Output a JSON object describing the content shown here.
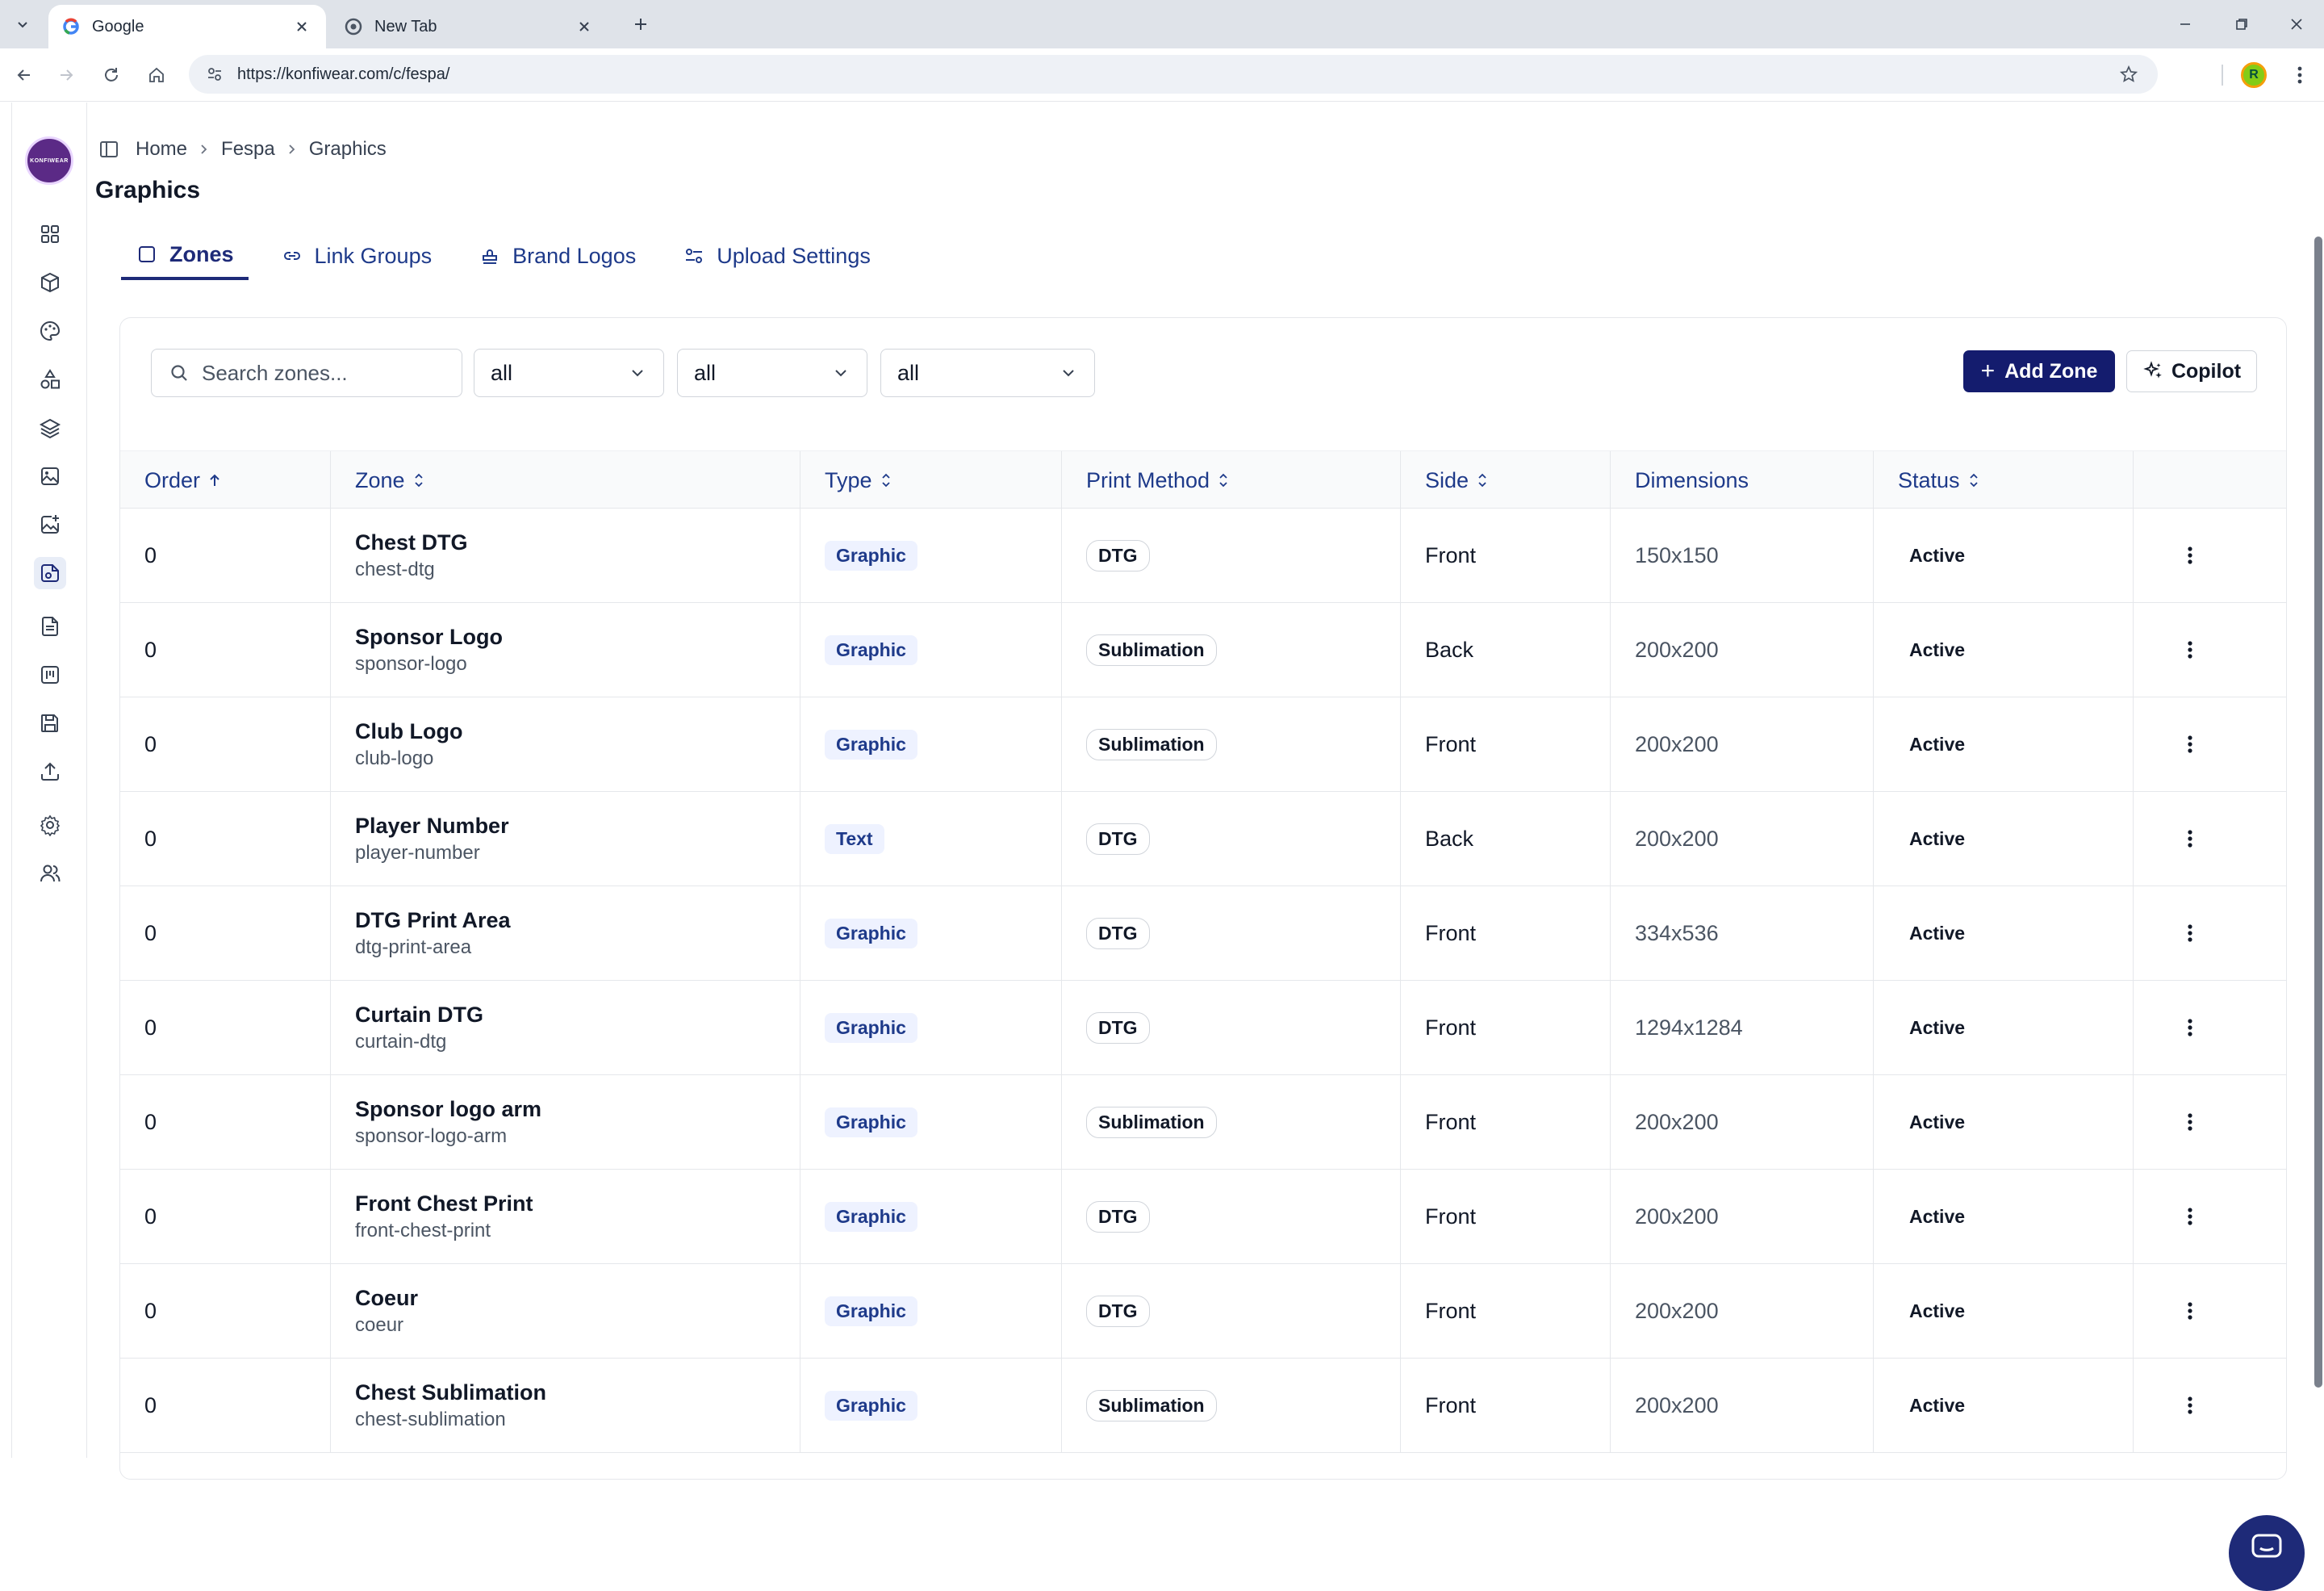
{
  "browser": {
    "tabs": [
      {
        "title": "Google",
        "active": true
      },
      {
        "title": "New Tab",
        "active": false
      }
    ],
    "url": "https://konfiwear.com/c/fespa/"
  },
  "sidebar": {
    "org_initials": "KONFIWEAR",
    "items": [
      "dashboard-icon",
      "box-icon",
      "palette-icon",
      "shapes-icon",
      "layers-icon",
      "image-icon",
      "image-plus-icon",
      "graphics-icon",
      "document-icon",
      "board-icon",
      "save-icon",
      "upload-icon",
      "gear-icon",
      "users-icon"
    ],
    "active_index": 7
  },
  "breadcrumb": [
    "Home",
    "Fespa",
    "Graphics"
  ],
  "page_title": "Graphics",
  "tabs": [
    {
      "label": "Zones",
      "icon": "square-icon",
      "active": true
    },
    {
      "label": "Link Groups",
      "icon": "link-icon",
      "active": false
    },
    {
      "label": "Brand Logos",
      "icon": "stamp-icon",
      "active": false
    },
    {
      "label": "Upload Settings",
      "icon": "sliders-icon",
      "active": false
    }
  ],
  "filters": {
    "search_placeholder": "Search zones...",
    "search_value": "",
    "type_filter": "all",
    "method_filter": "all",
    "side_filter": "all"
  },
  "actions": {
    "add_zone": "Add Zone",
    "copilot": "Copilot"
  },
  "table": {
    "headers": [
      "Order",
      "Zone",
      "Type",
      "Print Method",
      "Side",
      "Dimensions",
      "Status"
    ],
    "rows": [
      {
        "order": "0",
        "name": "Chest DTG",
        "slug": "chest-dtg",
        "type": "Graphic",
        "method": "DTG",
        "side": "Front",
        "dimensions": "150x150",
        "status": "Active"
      },
      {
        "order": "0",
        "name": "Sponsor Logo",
        "slug": "sponsor-logo",
        "type": "Graphic",
        "method": "Sublimation",
        "side": "Back",
        "dimensions": "200x200",
        "status": "Active"
      },
      {
        "order": "0",
        "name": "Club Logo",
        "slug": "club-logo",
        "type": "Graphic",
        "method": "Sublimation",
        "side": "Front",
        "dimensions": "200x200",
        "status": "Active"
      },
      {
        "order": "0",
        "name": "Player Number",
        "slug": "player-number",
        "type": "Text",
        "method": "DTG",
        "side": "Back",
        "dimensions": "200x200",
        "status": "Active"
      },
      {
        "order": "0",
        "name": "DTG Print Area",
        "slug": "dtg-print-area",
        "type": "Graphic",
        "method": "DTG",
        "side": "Front",
        "dimensions": "334x536",
        "status": "Active"
      },
      {
        "order": "0",
        "name": "Curtain DTG",
        "slug": "curtain-dtg",
        "type": "Graphic",
        "method": "DTG",
        "side": "Front",
        "dimensions": "1294x1284",
        "status": "Active"
      },
      {
        "order": "0",
        "name": "Sponsor logo arm",
        "slug": "sponsor-logo-arm",
        "type": "Graphic",
        "method": "Sublimation",
        "side": "Front",
        "dimensions": "200x200",
        "status": "Active"
      },
      {
        "order": "0",
        "name": "Front Chest Print",
        "slug": "front-chest-print",
        "type": "Graphic",
        "method": "DTG",
        "side": "Front",
        "dimensions": "200x200",
        "status": "Active"
      },
      {
        "order": "0",
        "name": "Coeur",
        "slug": "coeur",
        "type": "Graphic",
        "method": "DTG",
        "side": "Front",
        "dimensions": "200x200",
        "status": "Active"
      },
      {
        "order": "0",
        "name": "Chest Sublimation",
        "slug": "chest-sublimation",
        "type": "Graphic",
        "method": "Sublimation",
        "side": "Front",
        "dimensions": "200x200",
        "status": "Active"
      }
    ]
  },
  "colors": {
    "primary": "#141c6e",
    "accent_text": "#1e3a8a",
    "type_badge_bg": "#eef2ff"
  }
}
